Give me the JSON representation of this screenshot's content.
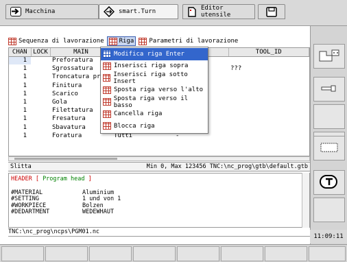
{
  "tabs": [
    {
      "label": "Macchina",
      "icon": "arrow-right-icon"
    },
    {
      "label": "smart.Turn",
      "icon": "diamond-arrows-icon"
    },
    {
      "label": "Editor utensile",
      "icon": "document-icon"
    },
    {
      "label": "",
      "icon": "floppy-icon"
    }
  ],
  "menubar": {
    "items": [
      "Sequenza di lavorazione",
      "Riga",
      "Parametri di lavorazione"
    ]
  },
  "table": {
    "headers": [
      "CHAN",
      "LOCK",
      "MAIN",
      "",
      "TOOL_ID"
    ],
    "rows": [
      {
        "chan": "1",
        "name": "Preforatura",
        "c": "",
        "d": "",
        "tool": ""
      },
      {
        "chan": "1",
        "name": "Sgrossatura",
        "c": "",
        "d": "",
        "tool": "???"
      },
      {
        "chan": "1",
        "name": "Troncatura pro",
        "c": "",
        "d": "",
        "tool": ""
      },
      {
        "chan": "1",
        "name": "Finitura",
        "c": "",
        "d": "",
        "tool": ""
      },
      {
        "chan": "1",
        "name": "Scarico",
        "c": "",
        "d": "",
        "tool": ""
      },
      {
        "chan": "1",
        "name": "Gola",
        "c": "",
        "d": "",
        "tool": ""
      },
      {
        "chan": "1",
        "name": "Filettatura",
        "c": "",
        "d": "",
        "tool": ""
      },
      {
        "chan": "1",
        "name": "Fresatura",
        "c": "Tutti",
        "d": "",
        "tool": ""
      },
      {
        "chan": "1",
        "name": "Sbavatura",
        "c": "Tutti",
        "d": "-",
        "tool": ""
      },
      {
        "chan": "1",
        "name": "Foratura",
        "c": "Tutti",
        "d": "-",
        "tool": ""
      }
    ]
  },
  "status": {
    "left": "Slitta",
    "right": "Min 0, Max 123456  TNC:\\nc_prog\\gtb\\default.gtb"
  },
  "editor": {
    "header": "HEADER [ ",
    "header_label": "Program head",
    "header_end": " ]",
    "lines": [
      {
        "k": "#MATERIAL",
        "v": "Aluminium"
      },
      {
        "k": "#SETTING",
        "v": "1 und  von 1"
      },
      {
        "k": "#WORKPIECE",
        "v": "Bolzen"
      },
      {
        "k": "#DEDARTMENT",
        "v": "WEDEWHAUT"
      }
    ]
  },
  "path": "TNC:\\nc_prog\\ncps\\PGM01.nc",
  "clock": "11:09:11",
  "dropdown": [
    "Modifica riga Enter",
    "Inserisci riga sopra",
    "Inserisci riga sotto Insert",
    "Sposta riga verso l'alto",
    "Sposta riga verso il basso",
    "Cancella riga",
    "Blocca riga"
  ],
  "colors": {
    "menu_highlight": "#3366cc",
    "header_keyword": "#cc0000",
    "header_label": "#008000"
  }
}
